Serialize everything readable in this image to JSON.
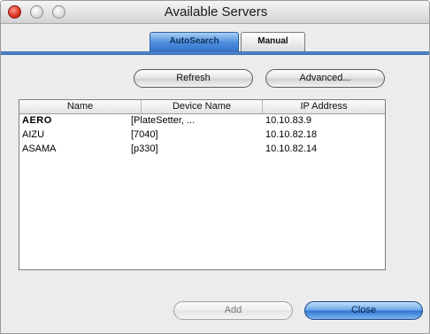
{
  "window": {
    "title": "Available Servers"
  },
  "tabs": [
    {
      "label": "AutoSearch",
      "active": true
    },
    {
      "label": "Manual",
      "active": false
    }
  ],
  "toolbar": {
    "refresh_label": "Refresh",
    "advanced_label": "Advanced..."
  },
  "table": {
    "columns": [
      "Name",
      "Device Name",
      "IP Address"
    ],
    "rows": [
      {
        "name": "AERO",
        "device": "[PlateSetter, ...",
        "ip": "10.10.83.9"
      },
      {
        "name": "AIZU",
        "device": "[7040]",
        "ip": "10.10.82.18"
      },
      {
        "name": "ASAMA",
        "device": "[p330]",
        "ip": "10.10.82.14"
      }
    ]
  },
  "footer": {
    "add_label": "Add",
    "close_label": "Close"
  },
  "colors": {
    "accent": "#3776cc",
    "close_red": "#d8321f"
  }
}
